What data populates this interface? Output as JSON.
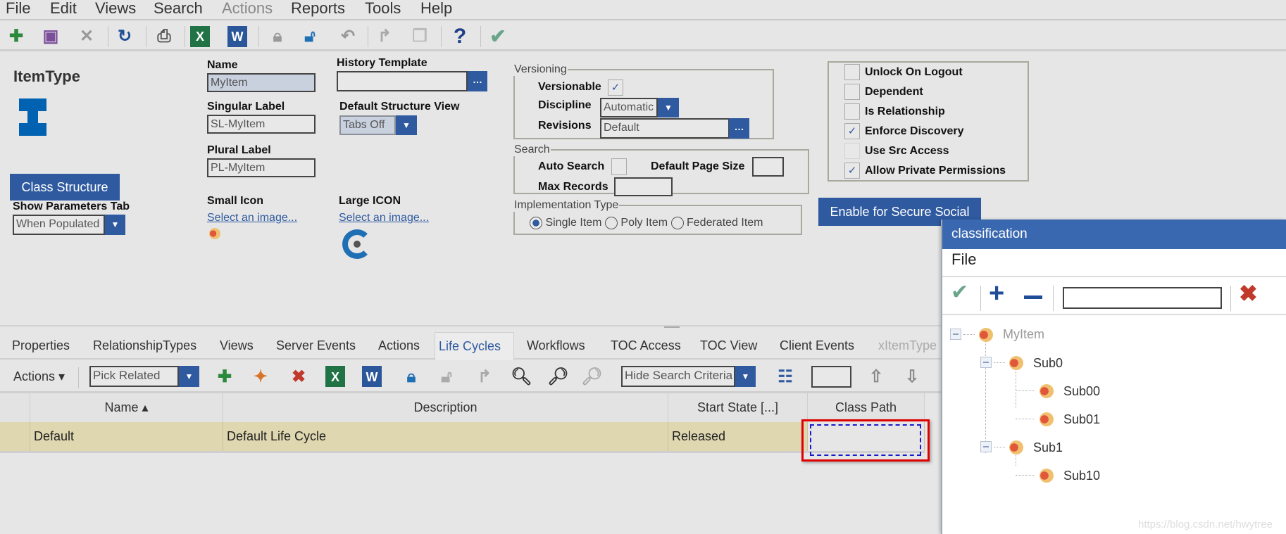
{
  "menu": [
    "File",
    "Edit",
    "Views",
    "Search",
    "Actions",
    "Reports",
    "Tools",
    "Help"
  ],
  "toolbar_icons": [
    "new-icon",
    "save-icon",
    "discard-icon",
    "refresh-icon",
    "print-icon",
    "excel-icon",
    "word-icon",
    "lock-icon",
    "unlock-icon",
    "undo-icon",
    "promote-icon",
    "copy-icon",
    "help-icon",
    "done-icon"
  ],
  "form": {
    "item_title": "ItemType",
    "name_label": "Name",
    "name_value": "MyItem",
    "history_label": "History Template",
    "history_value": "",
    "singular_label": "Singular Label",
    "singular_value": "SL-MyItem",
    "structure_label": "Default Structure View",
    "structure_value": "Tabs Off",
    "plural_label": "Plural Label",
    "plural_value": "PL-MyItem",
    "class_structure_button": "Class Structure",
    "params_label": "Show Parameters Tab",
    "params_value": "When Populated",
    "small_icon_label": "Small Icon",
    "large_icon_label": "Large ICON",
    "select_image": "Select an image...",
    "dots": "…"
  },
  "versioning": {
    "legend": "Versioning",
    "versionable_label": "Versionable",
    "versionable": true,
    "discipline_label": "Discipline",
    "discipline_value": "Automatic",
    "revisions_label": "Revisions",
    "revisions_value": "Default"
  },
  "search": {
    "legend": "Search",
    "auto_search_label": "Auto Search",
    "auto_search": false,
    "page_size_label": "Default Page Size",
    "page_size_value": "",
    "max_records_label": "Max Records",
    "max_records_value": ""
  },
  "implementation": {
    "legend": "Implementation Type",
    "options": [
      "Single Item",
      "Poly Item",
      "Federated Item"
    ],
    "selected": "Single Item"
  },
  "flags": [
    {
      "label": "Unlock On Logout",
      "checked": false
    },
    {
      "label": "Dependent",
      "checked": false
    },
    {
      "label": "Is Relationship",
      "checked": false
    },
    {
      "label": "Enforce Discovery",
      "checked": true
    },
    {
      "label": "Use Src Access",
      "checked": false
    },
    {
      "label": "Allow Private Permissions",
      "checked": true
    }
  ],
  "check": "✓",
  "secure_social_button": "Enable for Secure Social",
  "tabs": [
    "Properties",
    "RelationshipTypes",
    "Views",
    "Server Events",
    "Actions",
    "Life Cycles",
    "Workflows",
    "TOC Access",
    "TOC View",
    "Client Events",
    "xItemType"
  ],
  "active_tab": "Life Cycles",
  "grid_toolbar": {
    "actions_label": "Actions ▾",
    "pick_value": "Pick Related",
    "criteria_value": "Hide Search Criteria"
  },
  "grid": {
    "columns": [
      "",
      "Name ▴",
      "Description",
      "Start State [...]",
      "Class Path"
    ],
    "rows": [
      {
        "name": "Default",
        "description": "Default Life Cycle",
        "start_state": "Released",
        "class_path": ""
      }
    ]
  },
  "classification": {
    "title": "classification",
    "menu": "File",
    "search_value": "",
    "tree": [
      {
        "label": "MyItem",
        "level": 0,
        "expanded": true,
        "disabled": true
      },
      {
        "label": "Sub0",
        "level": 1,
        "expanded": true
      },
      {
        "label": "Sub00",
        "level": 2
      },
      {
        "label": "Sub01",
        "level": 2
      },
      {
        "label": "Sub1",
        "level": 1,
        "expanded": true
      },
      {
        "label": "Sub10",
        "level": 2
      }
    ]
  },
  "watermark": "https://blog.csdn.net/hwytree",
  "colors": {
    "accent": "#2f5aa0",
    "row_selected": "#dfd7b0",
    "highlight": "#e00000"
  }
}
